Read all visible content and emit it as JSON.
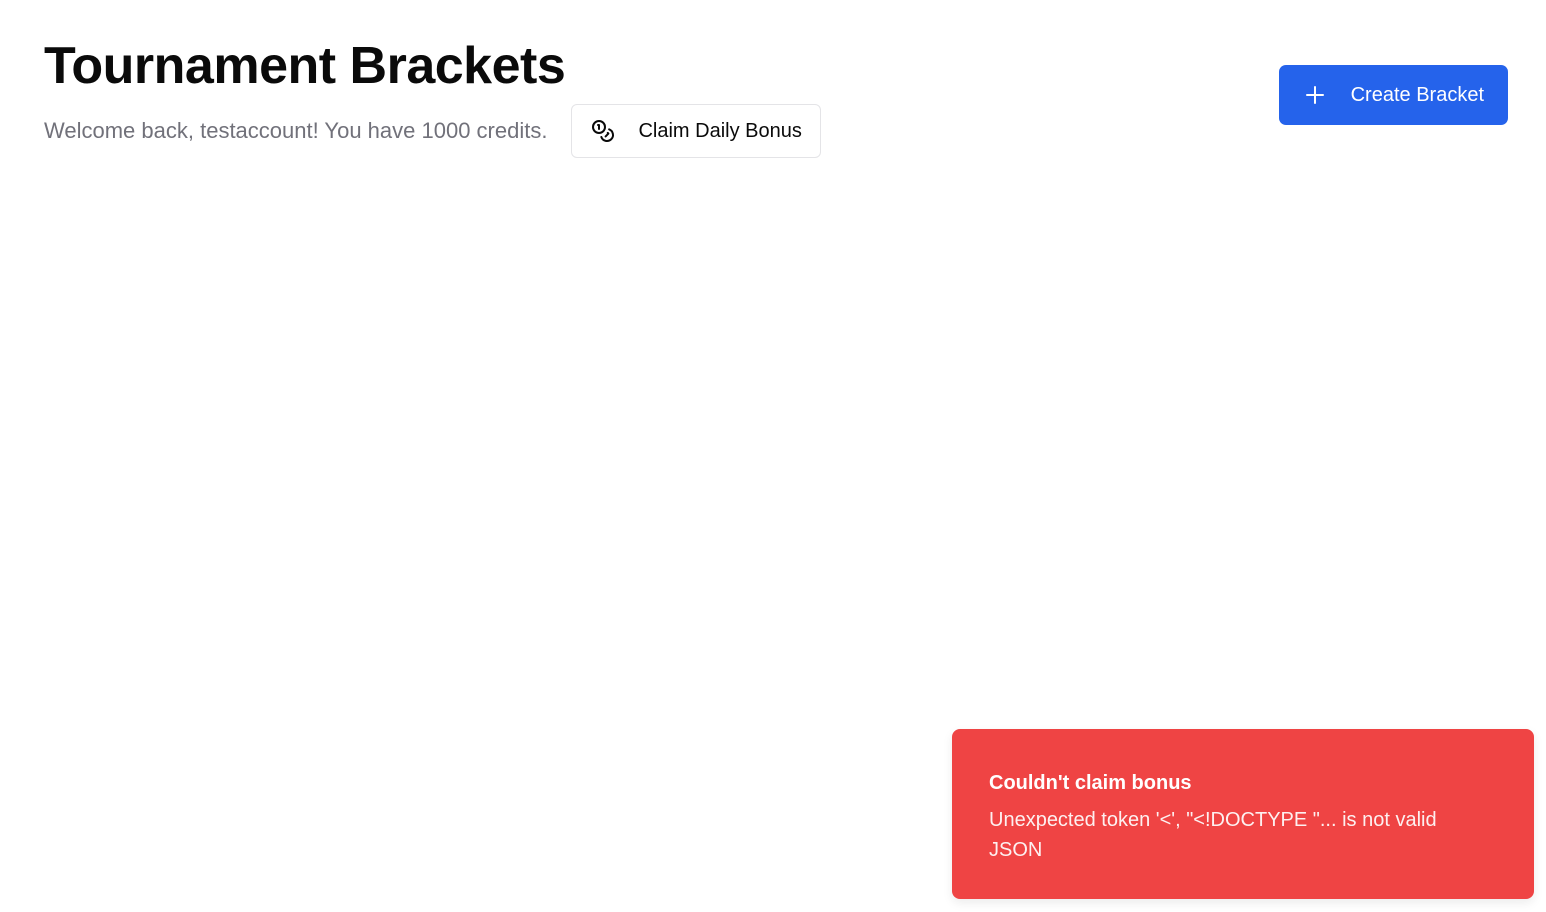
{
  "header": {
    "title": "Tournament Brackets",
    "welcome_text": "Welcome back, testaccount! You have 1000 credits.",
    "claim_bonus_label": "Claim Daily Bonus",
    "claim_bonus_icon": "coins-icon",
    "create_bracket_label": "Create Bracket",
    "create_bracket_icon": "plus-icon"
  },
  "toast": {
    "title": "Couldn't claim bonus",
    "description": "Unexpected token '<', \"<!DOCTYPE \"... is not valid JSON"
  },
  "colors": {
    "primary": "#2563eb",
    "destructive": "#ef4444",
    "muted_text": "#71717a"
  }
}
